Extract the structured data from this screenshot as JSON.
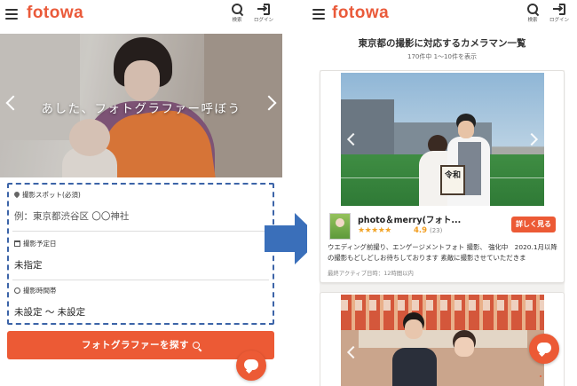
{
  "brand": {
    "logo_text": "fotowa",
    "accent": "#ec5a35",
    "arrow_color": "#3a6fba"
  },
  "header": {
    "search_label": "検索",
    "login_label": "ログイン",
    "icons": [
      "hamburger-menu-icon",
      "search-icon",
      "login-icon"
    ]
  },
  "left": {
    "hero_caption": "あした、フォトグラファー呼ぼう",
    "form": {
      "spot_label": "撮影スポット(必須)",
      "spot_placeholder": "例：東京都渋谷区 〇〇神社",
      "date_label": "撮影予定日",
      "date_value": "未指定",
      "time_label": "撮影時間帯",
      "time_value": "未設定 ～ 未設定"
    },
    "cta_label": "フォトグラファーを探す"
  },
  "right": {
    "title": "東京都の撮影に対応するカメラマン一覧",
    "subtitle": "170件中 1〜10件を表示",
    "cards": [
      {
        "photo_sign_text": "令和",
        "name": "photo＆merry(フォト...",
        "stars": "★★★★★",
        "rating": "4.9",
        "review_count": "(23)",
        "detail_button": "詳しく見る",
        "description": "ウエディング前撮り、エンゲージメントフォト 撮影、 強化中　2020.1月以降の撮影もどしどしお待ちしております 素敵に撮影させていただきま",
        "last_active": "最終アクティブ日時：12時間以内"
      }
    ]
  }
}
